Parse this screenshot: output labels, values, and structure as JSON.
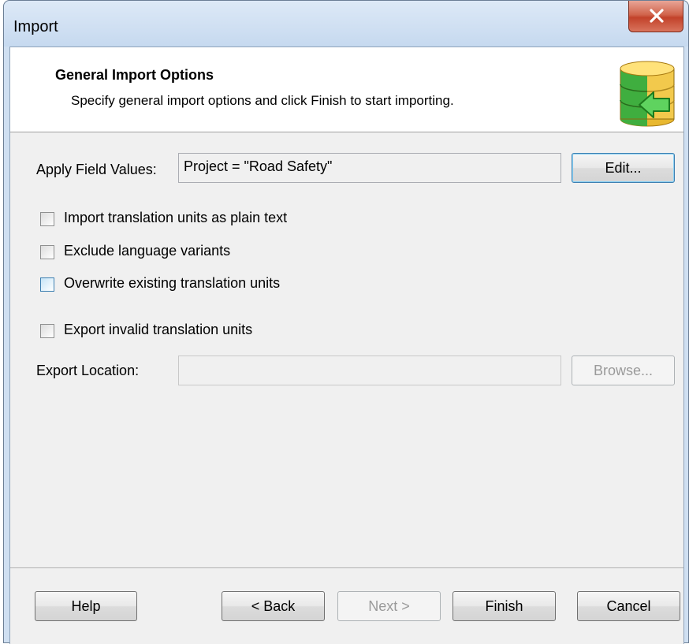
{
  "window": {
    "title": "Import"
  },
  "header": {
    "title": "General Import Options",
    "subtitle": "Specify general import options and click Finish to start importing."
  },
  "apply_field_values": {
    "label": "Apply Field Values:",
    "value": "Project = \"Road Safety\"",
    "edit_label": "Edit..."
  },
  "options": [
    {
      "label": "Import translation units as plain text",
      "checked": false
    },
    {
      "label": "Exclude language variants",
      "checked": false
    },
    {
      "label": "Overwrite existing translation units",
      "checked": false
    },
    {
      "label": "Export invalid translation units",
      "checked": false
    }
  ],
  "export_location": {
    "label": "Export Location:",
    "value": "",
    "browse_label": "Browse..."
  },
  "footer": {
    "help": "Help",
    "back": "< Back",
    "next": "Next >",
    "finish": "Finish",
    "cancel": "Cancel"
  },
  "colors": {
    "title_bar": "#cfdff1",
    "close_button": "#c2422a",
    "default_button_border": "#3c7fb1"
  }
}
